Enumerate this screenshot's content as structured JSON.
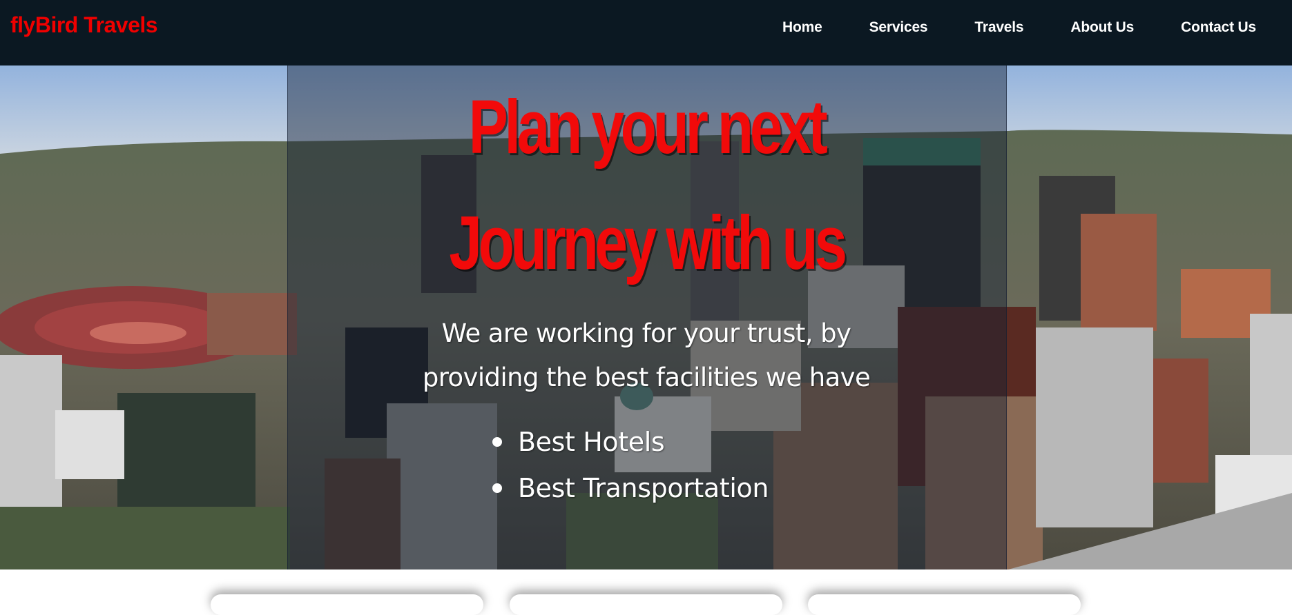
{
  "brand": {
    "name": "flyBird Travels"
  },
  "nav": {
    "items": [
      {
        "label": "Home"
      },
      {
        "label": "Services"
      },
      {
        "label": "Travels"
      },
      {
        "label": "About Us"
      },
      {
        "label": "Contact Us"
      }
    ]
  },
  "hero": {
    "headline_line1": "Plan your next",
    "headline_line2": "Journey with us",
    "tagline_line1": "We are working for your trust, by",
    "tagline_line2": "providing the best facilities we have",
    "features": [
      {
        "label": "Best Hotels"
      },
      {
        "label": "Best Transportation"
      }
    ],
    "background_image": "aerial city skyline"
  },
  "colors": {
    "navbar_bg": "#0b1822",
    "brand": "#f00000",
    "headline": "#f20a0a",
    "text": "#ffffff"
  }
}
